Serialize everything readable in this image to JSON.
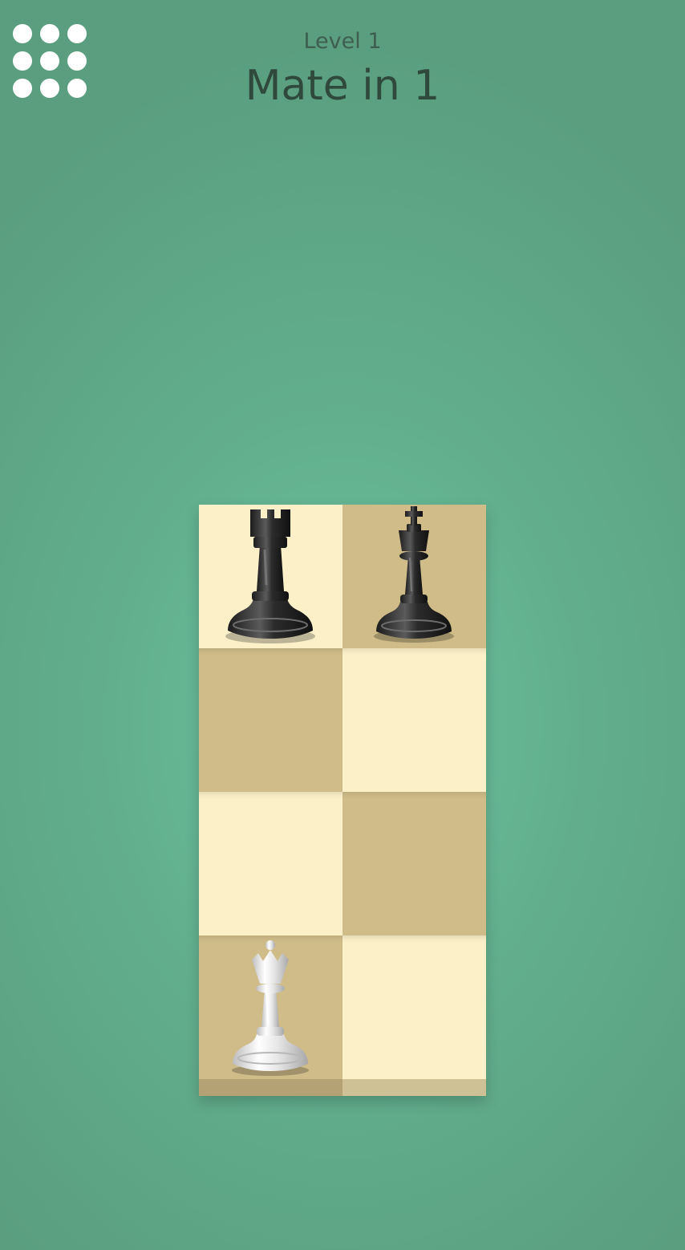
{
  "header": {
    "level": "Level 1",
    "title": "Mate in 1"
  },
  "menu": {
    "icon": "grid-menu-icon"
  },
  "board": {
    "columns": 2,
    "rows": 4,
    "colors": {
      "light": "#fbf0c8",
      "dark": "#cfbc89",
      "background": "#62af8d"
    },
    "pieces": [
      {
        "piece": "rook",
        "color": "black",
        "row": 1,
        "col": 1
      },
      {
        "piece": "king",
        "color": "black",
        "row": 1,
        "col": 2
      },
      {
        "piece": "queen",
        "color": "white",
        "row": 4,
        "col": 1
      }
    ]
  }
}
